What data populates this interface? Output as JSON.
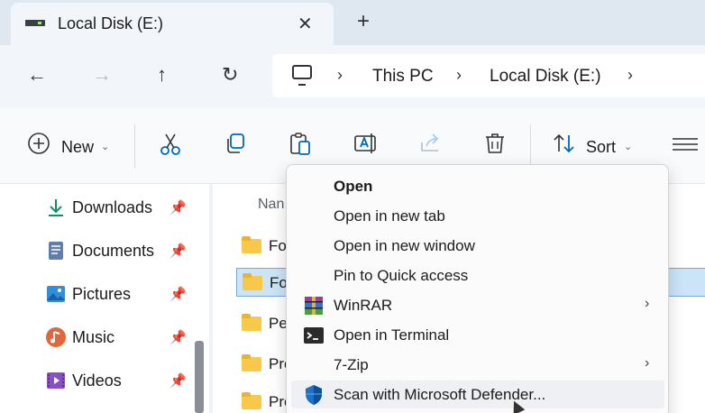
{
  "tab": {
    "title": "Local Disk (E:)",
    "close_glyph": "✕",
    "new_tab_glyph": "+"
  },
  "nav": {
    "back_glyph": "←",
    "forward_glyph": "→",
    "up_glyph": "↑",
    "refresh_glyph": "↻",
    "breadcrumb": [
      "This PC",
      "Local Disk (E:)"
    ],
    "sep_glyph": "›"
  },
  "toolbar": {
    "new_label": "New",
    "sort_label": "Sort",
    "chevron_glyph": "⌄",
    "icons": [
      "plus-circle-icon",
      "cut-icon",
      "copy-icon",
      "paste-icon",
      "rename-icon",
      "share-icon",
      "delete-icon",
      "sort-icon",
      "view-icon"
    ]
  },
  "sidebar": {
    "items": [
      {
        "label": "Downloads",
        "icon": "download-icon"
      },
      {
        "label": "Documents",
        "icon": "documents-icon"
      },
      {
        "label": "Pictures",
        "icon": "pictures-icon"
      },
      {
        "label": "Music",
        "icon": "music-icon"
      },
      {
        "label": "Videos",
        "icon": "videos-icon"
      }
    ],
    "pin_glyph": "📌"
  },
  "filelist": {
    "column_name": "Nan",
    "rows": [
      "Fo",
      "Fo",
      "Pe",
      "Pro",
      "Pro"
    ],
    "selected_index": 1
  },
  "context_menu": {
    "items": [
      {
        "label": "Open",
        "bold": true
      },
      {
        "label": "Open in new tab"
      },
      {
        "label": "Open in new window"
      },
      {
        "label": "Pin to Quick access"
      },
      {
        "label": "WinRAR",
        "icon": "winrar-icon",
        "submenu": true
      },
      {
        "label": "Open in Terminal",
        "icon": "terminal-icon"
      },
      {
        "label": "7-Zip",
        "submenu": true
      },
      {
        "label": "Scan with Microsoft Defender...",
        "icon": "defender-icon"
      }
    ],
    "submenu_glyph": "›"
  },
  "colors": {
    "accent": "#0078d4",
    "folder": "#f7c849",
    "selection": "#cce4f7"
  }
}
